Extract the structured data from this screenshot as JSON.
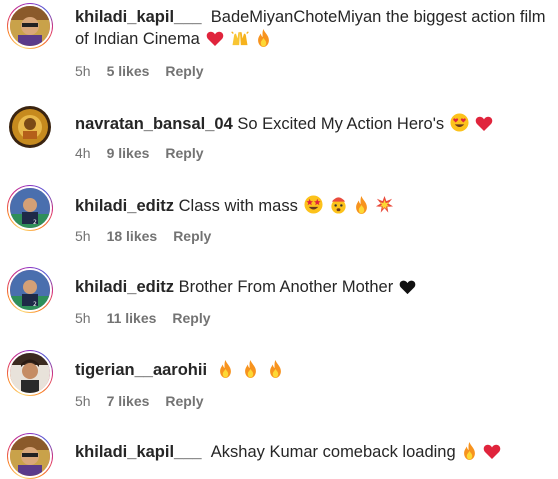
{
  "comments": [
    {
      "username": "khiladi_kapil___",
      "text_line1": "BadeMiyanChoteMiyan the biggest action film",
      "text_line2": "of Indian Cinema",
      "emojis": [
        "red-heart",
        "raising-hands",
        "fire"
      ],
      "time": "5h",
      "likes": "5 likes",
      "reply": "Reply",
      "avatar_ring": true
    },
    {
      "username": "navratan_bansal_04",
      "text": "So Excited My Action Hero's",
      "emojis": [
        "heart-eyes",
        "red-heart"
      ],
      "time": "4h",
      "likes": "9 likes",
      "reply": "Reply",
      "avatar_ring": false
    },
    {
      "username": "khiladi_editz",
      "text": "Class with mass",
      "emojis": [
        "star-struck",
        "exploding-head",
        "fire",
        "collision"
      ],
      "time": "5h",
      "likes": "18 likes",
      "reply": "Reply",
      "avatar_ring": true
    },
    {
      "username": "khiladi_editz",
      "text": "Brother From Another Mother",
      "emojis": [
        "black-heart"
      ],
      "time": "5h",
      "likes": "11 likes",
      "reply": "Reply",
      "avatar_ring": true
    },
    {
      "username": "tigerian__aarohii",
      "text": "",
      "emojis": [
        "fire",
        "fire",
        "fire"
      ],
      "time": "5h",
      "likes": "7 likes",
      "reply": "Reply",
      "avatar_ring": true
    },
    {
      "username": "khiladi_kapil___",
      "text": "Akshay Kumar comeback loading",
      "emojis": [
        "fire",
        "red-heart"
      ],
      "avatar_ring": true
    }
  ],
  "colors": {
    "text": "#262626",
    "meta": "#737373",
    "heart": "#e0243c",
    "fire": "#f7931e"
  }
}
